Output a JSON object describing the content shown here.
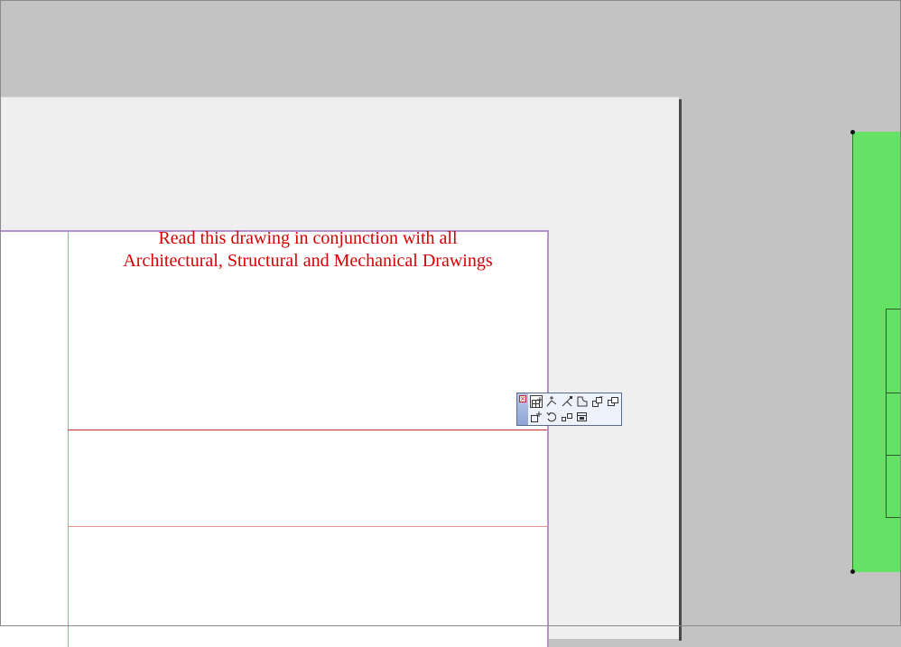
{
  "drawing": {
    "note_line_1": "Read this drawing in conjunction with all",
    "note_line_2": "Architectural, Structural and Mechanical Drawings"
  },
  "colors": {
    "canvas_background": "#c3c3c3",
    "sheet": "#efefef",
    "print_area_border": "#b88fd0",
    "note_text": "#d40000",
    "green_panel": "#65e265"
  },
  "toolbar": {
    "buttons": [
      {
        "icon": "edit-grid-icon"
      },
      {
        "icon": "add-vertex-icon"
      },
      {
        "icon": "stretch-icon"
      },
      {
        "icon": "fillet-icon"
      },
      {
        "icon": "move-icon"
      },
      {
        "icon": "copy-icon"
      },
      {
        "icon": "offset-icon"
      },
      {
        "icon": "rotate-icon"
      },
      {
        "icon": "mirror-icon"
      },
      {
        "icon": "resize-icon"
      }
    ]
  }
}
